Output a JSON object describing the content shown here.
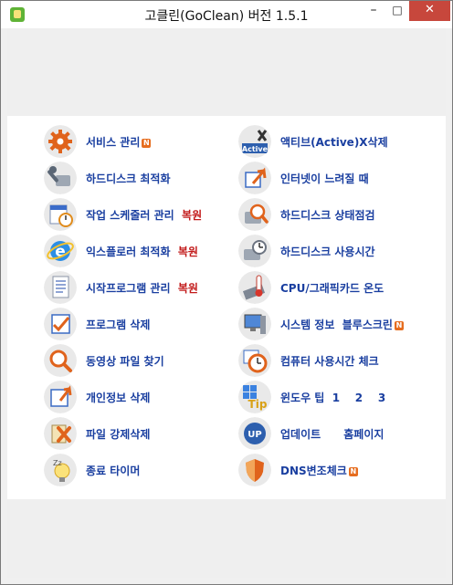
{
  "window": {
    "title": "고클린(GoClean) 버전 1.5.1",
    "minimize": "–",
    "maximize": "□",
    "close": "✕"
  },
  "left": [
    {
      "label": "서비스 관리",
      "badge": "N",
      "icon": "gear-icon"
    },
    {
      "label": "하드디스크 최적화",
      "icon": "wrench-disk-icon"
    },
    {
      "label": "작업 스케줄러 관리",
      "extra": "복원",
      "icon": "scheduler-icon"
    },
    {
      "label": "익스플로러 최적화",
      "extra": "복원",
      "icon": "ie-icon"
    },
    {
      "label": "시작프로그램 관리",
      "extra": "복원",
      "icon": "document-icon"
    },
    {
      "label": "프로그램 삭제",
      "icon": "checklist-icon"
    },
    {
      "label": "동영상 파일 찾기",
      "icon": "magnifier-icon"
    },
    {
      "label": "개인정보 삭제",
      "icon": "privacy-icon"
    },
    {
      "label": "파일 강제삭제",
      "icon": "delete-file-icon"
    },
    {
      "label": "종료 타이머",
      "icon": "sleep-bulb-icon"
    }
  ],
  "right": [
    {
      "label": "액티브(Active)X삭제",
      "icon": "activex-icon",
      "iconText": "Active"
    },
    {
      "label": "인터넷이 느려질 때",
      "icon": "internet-icon"
    },
    {
      "label": "하드디스크 상태점검",
      "icon": "disk-check-icon"
    },
    {
      "label": "하드디스크 사용시간",
      "icon": "disk-time-icon"
    },
    {
      "label": "CPU/그래픽카드 온도",
      "icon": "temperature-icon"
    },
    {
      "label": "시스템 정보",
      "label2": "블루스크린",
      "badge": "N",
      "icon": "computer-icon"
    },
    {
      "label": "컴퓨터 사용시간 체크",
      "icon": "clock-icon"
    },
    {
      "label": "윈도우 팁",
      "n1": "1",
      "n2": "2",
      "n3": "3",
      "icon": "tip-icon",
      "iconText": "Tip"
    },
    {
      "label": "업데이트",
      "label2": "홈페이지",
      "icon": "update-icon",
      "iconText": "UP"
    },
    {
      "label": "DNS변조체크",
      "badge": "N",
      "icon": "shield-icon"
    }
  ],
  "colors": {
    "label": "#1a3fa0",
    "restore": "#c21919",
    "badge": "#e66d1f",
    "close": "#c7473c"
  }
}
